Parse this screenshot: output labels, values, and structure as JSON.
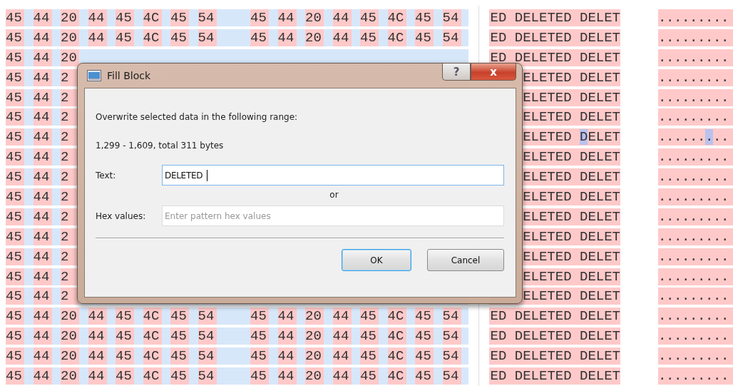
{
  "hex_rows": [
    {
      "hex_group_1": [
        "45",
        "44",
        "20",
        "44",
        "45",
        "4C",
        "45",
        "54"
      ],
      "hex_group_2": [
        "45",
        "44",
        "20",
        "44",
        "45",
        "4C",
        "45",
        "54"
      ],
      "text": "ED DELETED DELET",
      "ascii": ".........",
      "caret": false
    },
    {
      "hex_group_1": [
        "45",
        "44",
        "20",
        "44",
        "45",
        "4C",
        "45",
        "54"
      ],
      "hex_group_2": [
        "45",
        "44",
        "20",
        "44",
        "45",
        "4C",
        "45",
        "54"
      ],
      "text": "ED DELETED DELET",
      "ascii": ".........",
      "caret": false
    },
    {
      "hex_group_1": [
        "45",
        "44",
        "20"
      ],
      "text": "ED DELETED DELET",
      "ascii": ".........",
      "caret": false
    },
    {
      "hex_group_1": [
        "45",
        "44",
        "2"
      ],
      "text": "ELETED DELET",
      "ascii": ".........",
      "caret": false
    },
    {
      "hex_group_1": [
        "45",
        "44",
        "2"
      ],
      "text": "ELETED DELET",
      "ascii": ".........",
      "caret": false
    },
    {
      "hex_group_1": [
        "45",
        "44",
        "2"
      ],
      "text": "ELETED DELET",
      "ascii": ".........",
      "caret": false
    },
    {
      "hex_group_1": [
        "45",
        "44",
        "2"
      ],
      "text": "ELETED DELET",
      "ascii": ".........",
      "caret": true
    },
    {
      "hex_group_1": [
        "45",
        "44",
        "2"
      ],
      "text": "ELETED DELET",
      "ascii": ".........",
      "caret": false
    },
    {
      "hex_group_1": [
        "45",
        "44",
        "2"
      ],
      "text": "ELETED DELET",
      "ascii": ".........",
      "caret": false
    },
    {
      "hex_group_1": [
        "45",
        "44",
        "2"
      ],
      "text": "ELETED DELET",
      "ascii": ".........",
      "caret": false
    },
    {
      "hex_group_1": [
        "45",
        "44",
        "2"
      ],
      "text": "ELETED DELET",
      "ascii": ".........",
      "caret": false
    },
    {
      "hex_group_1": [
        "45",
        "44",
        "2"
      ],
      "text": "ELETED DELET",
      "ascii": ".........",
      "caret": false
    },
    {
      "hex_group_1": [
        "45",
        "44",
        "2"
      ],
      "text": "ELETED DELET",
      "ascii": ".........",
      "caret": false
    },
    {
      "hex_group_1": [
        "45",
        "44",
        "2"
      ],
      "text": "ELETED DELET",
      "ascii": ".........",
      "caret": false
    },
    {
      "hex_group_1": [
        "45",
        "44",
        "2"
      ],
      "text": "ELETED DELET",
      "ascii": ".........",
      "caret": false
    },
    {
      "hex_group_1": [
        "45",
        "44",
        "20",
        "44",
        "45",
        "4C",
        "45",
        "54"
      ],
      "hex_group_2": [
        "45",
        "44",
        "20",
        "44",
        "45",
        "4C",
        "45",
        "54"
      ],
      "text": "ED DELETED DELET",
      "ascii": ".........",
      "caret": false
    },
    {
      "hex_group_1": [
        "45",
        "44",
        "20",
        "44",
        "45",
        "4C",
        "45",
        "54"
      ],
      "hex_group_2": [
        "45",
        "44",
        "20",
        "44",
        "45",
        "4C",
        "45",
        "54"
      ],
      "text": "ED DELETED DELET",
      "ascii": ".........",
      "caret": false
    },
    {
      "hex_group_1": [
        "45",
        "44",
        "20",
        "44",
        "45",
        "4C",
        "45",
        "54"
      ],
      "hex_group_2": [
        "45",
        "44",
        "20",
        "44",
        "45",
        "4C",
        "45",
        "54"
      ],
      "text": "ED DELETED DELET",
      "ascii": ".........",
      "caret": false
    },
    {
      "hex_group_1": [
        "45",
        "44",
        "20",
        "44",
        "45",
        "4C",
        "45",
        "54"
      ],
      "hex_group_2": [
        "45",
        "44",
        "20",
        "44",
        "45",
        "4C",
        "45",
        "54"
      ],
      "text": "ED DELETED DELET",
      "ascii": ".........",
      "caret": false
    }
  ],
  "dialog": {
    "title": "Fill Block",
    "help_button": "?",
    "close_button": "x",
    "description": "Overwrite selected data in the following range:",
    "range": "1,299 - 1,609, total 311 bytes",
    "text_label": "Text:",
    "text_value": "DELETED",
    "or_label": "or",
    "hex_label": "Hex values:",
    "hex_placeholder": "Enter pattern hex values",
    "buttons": [
      {
        "label": "OK",
        "focused": true
      },
      {
        "label": "Cancel",
        "focused": false
      }
    ]
  }
}
